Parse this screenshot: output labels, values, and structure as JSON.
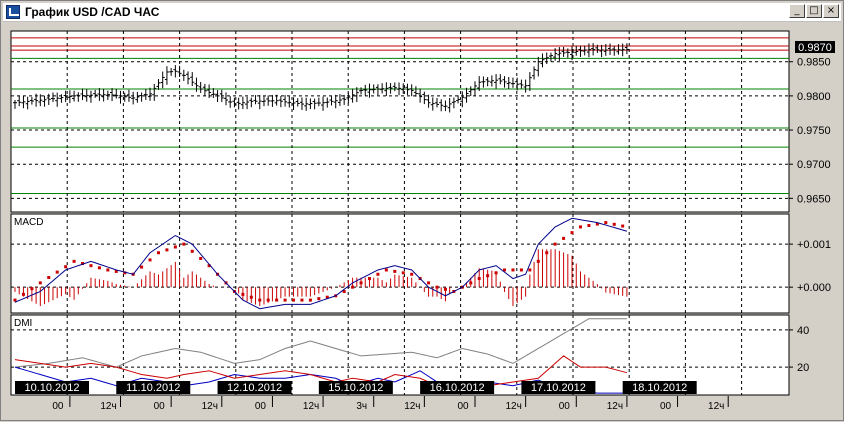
{
  "window": {
    "title": "График USD /CAD  ЧАС",
    "buttons": {
      "minimize": "_",
      "maximize": "□",
      "close": "×"
    }
  },
  "colors": {
    "panel_bg": "#ffffff",
    "grid": "#000000",
    "price_bar": "#000000",
    "support_line": "#008000",
    "resistance_line": "#c00000",
    "macd_line": "#00008b",
    "signal_line": "#cc0000",
    "histogram": "#cc0000",
    "adx_line": "#808080",
    "di_plus": "#0000c0",
    "di_minus": "#cc0000",
    "date_label_bg": "#000000",
    "date_label_text": "#ffffff"
  },
  "chart_data": [
    {
      "type": "ohlc",
      "panel": "price",
      "ylim": [
        0.963,
        0.9895
      ],
      "y_ticks": [
        "0.9850",
        "0.9800",
        "0.9750",
        "0.9700",
        "0.9650"
      ],
      "y_tick_values": [
        0.985,
        0.98,
        0.975,
        0.97,
        0.965
      ],
      "last_price_label": "0.9870",
      "last_price": 0.987,
      "horizontal_levels": {
        "resistance": [
          0.9885,
          0.9873,
          0.9867
        ],
        "support": [
          0.9855,
          0.981,
          0.9753,
          0.9725,
          0.9657
        ]
      },
      "bar_count": 146,
      "close_anchors": [
        [
          0,
          0.979
        ],
        [
          8,
          0.9795
        ],
        [
          14,
          0.98
        ],
        [
          22,
          0.9802
        ],
        [
          28,
          0.9797
        ],
        [
          32,
          0.9803
        ],
        [
          36,
          0.9835
        ],
        [
          38,
          0.9836
        ],
        [
          40,
          0.983
        ],
        [
          44,
          0.981
        ],
        [
          48,
          0.98
        ],
        [
          52,
          0.9788
        ],
        [
          56,
          0.9792
        ],
        [
          62,
          0.9793
        ],
        [
          68,
          0.9788
        ],
        [
          73,
          0.979
        ],
        [
          78,
          0.9795
        ],
        [
          82,
          0.9808
        ],
        [
          86,
          0.981
        ],
        [
          90,
          0.9812
        ],
        [
          94,
          0.9808
        ],
        [
          98,
          0.979
        ],
        [
          102,
          0.9785
        ],
        [
          106,
          0.9798
        ],
        [
          110,
          0.982
        ],
        [
          114,
          0.9823
        ],
        [
          118,
          0.9818
        ],
        [
          121,
          0.9815
        ],
        [
          124,
          0.985
        ],
        [
          128,
          0.9862
        ],
        [
          132,
          0.9864
        ],
        [
          136,
          0.9868
        ],
        [
          140,
          0.9867
        ],
        [
          145,
          0.9868
        ]
      ]
    },
    {
      "type": "macd",
      "panel": "macd",
      "title": "MACD",
      "ylim": [
        -0.0006,
        0.0017
      ],
      "y_ticks": [
        "+0.001",
        "+0.000"
      ],
      "y_tick_values": [
        0.001,
        0.0
      ],
      "macd_anchors": [
        [
          0,
          -0.00035
        ],
        [
          6,
          -0.0001
        ],
        [
          12,
          0.0004
        ],
        [
          18,
          0.0006
        ],
        [
          24,
          0.0004
        ],
        [
          28,
          0.0003
        ],
        [
          32,
          0.0008
        ],
        [
          38,
          0.0012
        ],
        [
          42,
          0.001
        ],
        [
          48,
          0.0003
        ],
        [
          54,
          -0.0003
        ],
        [
          58,
          -0.0005
        ],
        [
          64,
          -0.0004
        ],
        [
          70,
          -0.0004
        ],
        [
          76,
          -0.0002
        ],
        [
          80,
          0.0001
        ],
        [
          86,
          0.0004
        ],
        [
          90,
          0.0005
        ],
        [
          94,
          0.0004
        ],
        [
          98,
          0.0
        ],
        [
          102,
          -0.0002
        ],
        [
          106,
          0.0
        ],
        [
          110,
          0.0004
        ],
        [
          114,
          0.0005
        ],
        [
          118,
          0.0002
        ],
        [
          121,
          0.0003
        ],
        [
          124,
          0.001
        ],
        [
          128,
          0.0014
        ],
        [
          132,
          0.0016
        ],
        [
          138,
          0.0015
        ],
        [
          145,
          0.0013
        ]
      ],
      "signal_anchors": [
        [
          0,
          -0.0003
        ],
        [
          6,
          0.0001
        ],
        [
          14,
          0.0006
        ],
        [
          22,
          0.0004
        ],
        [
          28,
          0.0003
        ],
        [
          34,
          0.0008
        ],
        [
          40,
          0.001
        ],
        [
          46,
          0.0005
        ],
        [
          52,
          -0.0001
        ],
        [
          58,
          -0.0003
        ],
        [
          64,
          -0.0003
        ],
        [
          70,
          -0.0003
        ],
        [
          76,
          -0.0002
        ],
        [
          82,
          0.0001
        ],
        [
          88,
          0.0004
        ],
        [
          94,
          0.0003
        ],
        [
          100,
          0.0
        ],
        [
          104,
          -0.0001
        ],
        [
          110,
          0.0002
        ],
        [
          116,
          0.0004
        ],
        [
          122,
          0.0004
        ],
        [
          128,
          0.001
        ],
        [
          134,
          0.0014
        ],
        [
          140,
          0.0015
        ],
        [
          145,
          0.0014
        ]
      ]
    },
    {
      "type": "line",
      "panel": "dmi",
      "title": "DMI",
      "ylim": [
        5,
        48
      ],
      "y_ticks": [
        "40",
        "20"
      ],
      "y_tick_values": [
        40,
        20
      ],
      "series": [
        {
          "key": "adx",
          "values_anchors": [
            [
              0,
              20
            ],
            [
              8,
              22
            ],
            [
              16,
              25
            ],
            [
              24,
              20
            ],
            [
              30,
              26
            ],
            [
              38,
              30
            ],
            [
              44,
              28
            ],
            [
              52,
              22
            ],
            [
              58,
              24
            ],
            [
              64,
              30
            ],
            [
              70,
              34
            ],
            [
              76,
              30
            ],
            [
              82,
              26
            ],
            [
              88,
              27
            ],
            [
              94,
              28
            ],
            [
              100,
              25
            ],
            [
              106,
              30
            ],
            [
              112,
              27
            ],
            [
              118,
              22
            ],
            [
              124,
              30
            ],
            [
              130,
              38
            ],
            [
              136,
              46
            ],
            [
              145,
              46
            ]
          ]
        },
        {
          "key": "di_plus",
          "values_anchors": [
            [
              0,
              20
            ],
            [
              6,
              16
            ],
            [
              12,
              12
            ],
            [
              18,
              14
            ],
            [
              24,
              10
            ],
            [
              30,
              14
            ],
            [
              36,
              12
            ],
            [
              40,
              10
            ],
            [
              46,
              12
            ],
            [
              52,
              16
            ],
            [
              58,
              14
            ],
            [
              64,
              14
            ],
            [
              70,
              16
            ],
            [
              76,
              14
            ],
            [
              80,
              10
            ],
            [
              86,
              14
            ],
            [
              90,
              12
            ],
            [
              96,
              18
            ],
            [
              100,
              12
            ],
            [
              106,
              10
            ],
            [
              112,
              12
            ],
            [
              118,
              10
            ],
            [
              124,
              13
            ],
            [
              130,
              8
            ],
            [
              138,
              6
            ],
            [
              145,
              6
            ]
          ]
        },
        {
          "key": "di_minus",
          "values_anchors": [
            [
              0,
              24
            ],
            [
              6,
              22
            ],
            [
              12,
              20
            ],
            [
              18,
              22
            ],
            [
              24,
              20
            ],
            [
              30,
              16
            ],
            [
              36,
              14
            ],
            [
              40,
              16
            ],
            [
              46,
              18
            ],
            [
              52,
              14
            ],
            [
              58,
              16
            ],
            [
              64,
              18
            ],
            [
              70,
              16
            ],
            [
              76,
              12
            ],
            [
              80,
              14
            ],
            [
              86,
              12
            ],
            [
              90,
              16
            ],
            [
              96,
              14
            ],
            [
              100,
              10
            ],
            [
              106,
              8
            ],
            [
              112,
              10
            ],
            [
              118,
              12
            ],
            [
              124,
              14
            ],
            [
              130,
              26
            ],
            [
              134,
              20
            ],
            [
              140,
              20
            ],
            [
              145,
              17
            ]
          ]
        }
      ]
    }
  ],
  "time_axis": {
    "dates": [
      {
        "label": "10.10.2012",
        "at": 0
      },
      {
        "label": "11.10.2012",
        "at": 24
      },
      {
        "label": "12.10.2012",
        "at": 48
      },
      {
        "label": "15.10.2012",
        "at": 72
      },
      {
        "label": "16.10.2012",
        "at": 96
      },
      {
        "label": "17.10.2012",
        "at": 120
      },
      {
        "label": "18.10.2012",
        "at": 144
      }
    ],
    "hours": [
      {
        "label": "00",
        "at": 4
      },
      {
        "label": "12ч",
        "at": 16
      },
      {
        "label": "00",
        "at": 28
      },
      {
        "label": "12ч",
        "at": 40
      },
      {
        "label": "00",
        "at": 52
      },
      {
        "label": "12ч",
        "at": 64
      },
      {
        "label": "3ч",
        "at": 76
      },
      {
        "label": "12ч",
        "at": 88
      },
      {
        "label": "00",
        "at": 100
      },
      {
        "label": "12ч",
        "at": 112
      },
      {
        "label": "00",
        "at": 124
      },
      {
        "label": "12ч",
        "at": 136
      },
      {
        "label": "00",
        "at": 148
      },
      {
        "label": "12ч",
        "at": 160
      }
    ]
  }
}
